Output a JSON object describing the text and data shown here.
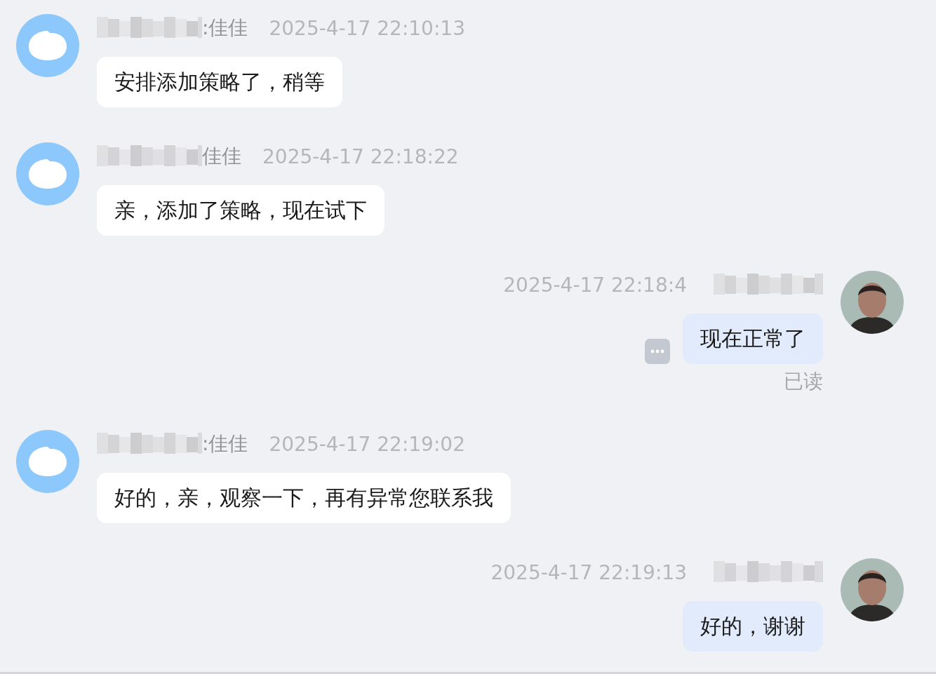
{
  "messages": [
    {
      "kind": "incoming",
      "sender": ":佳佳",
      "time": "2025-4-17 22:10:13",
      "text": "安排添加策略了，稍等"
    },
    {
      "kind": "incoming",
      "sender": "佳佳",
      "time": "2025-4-17 22:18:22",
      "text": "亲，添加了策略，现在试下"
    },
    {
      "kind": "outgoing",
      "time": "2025-4-17 22:18:4",
      "text": "现在正常了",
      "status": "已读",
      "more_button": true
    },
    {
      "kind": "incoming",
      "sender": ":佳佳",
      "time": "2025-4-17 22:19:02",
      "text": "好的，亲，观察一下，再有异常您联系我"
    },
    {
      "kind": "outgoing",
      "time": "2025-4-17 22:19:13",
      "text": "好的，谢谢"
    }
  ]
}
